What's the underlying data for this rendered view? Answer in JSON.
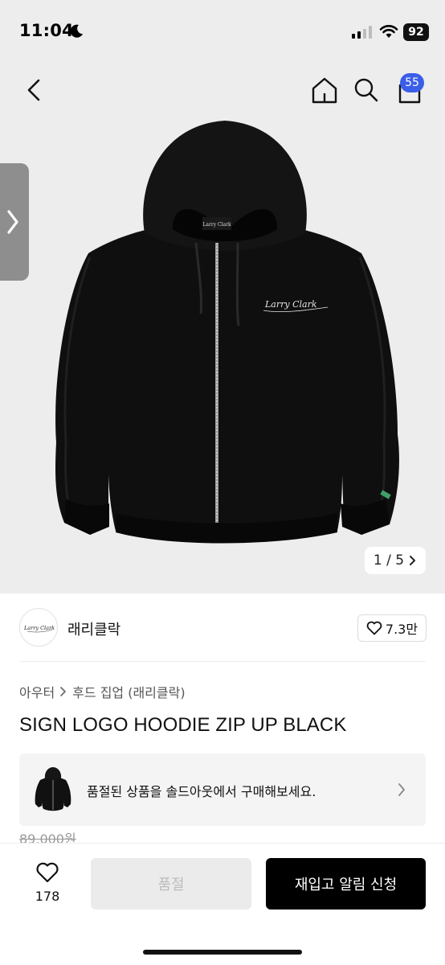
{
  "status": {
    "time": "11:04",
    "battery": "92"
  },
  "nav": {
    "cart_count": "55"
  },
  "gallery": {
    "pager": "1 / 5",
    "hoodie_logo_text": "Larry Clark"
  },
  "brand": {
    "name": "래리클락",
    "logo_text": "Larry Clark",
    "likes": "7.3만"
  },
  "breadcrumb": {
    "category": "아우터",
    "subcategory": "후드 집업 (래리클락)"
  },
  "product": {
    "title": "SIGN LOGO HOODIE ZIP UP BLACK",
    "original_price": "89,000원"
  },
  "soldout_banner": {
    "text": "품절된 상품을 솔드아웃에서 구매해보세요."
  },
  "bottom_bar": {
    "wish_count": "178",
    "soldout_label": "품절",
    "restock_label": "재입고 알림 신청"
  },
  "colors": {
    "badge": "#3a5ee8",
    "primary_button": "#000000",
    "disabled_button": "#ebebeb",
    "hero_bg": "#ededed"
  }
}
